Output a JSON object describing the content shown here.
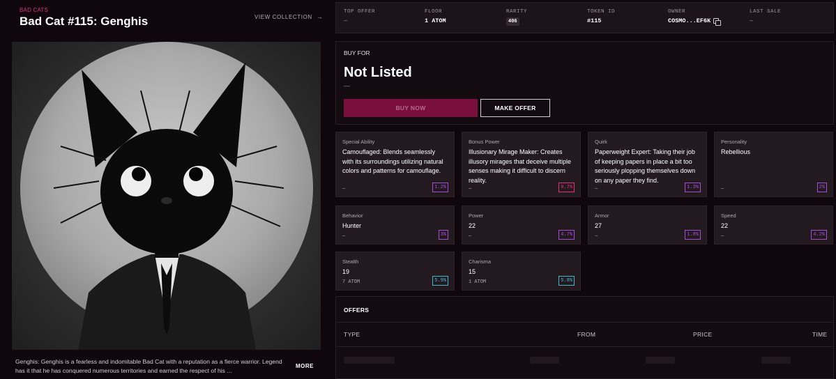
{
  "header": {
    "collection_tag": "BAD CATS",
    "title": "Bad Cat #115: Genghis",
    "view_collection": "VIEW COLLECTION"
  },
  "description": {
    "text": "Genghis: Genghis is a fearless and indomitable Bad Cat with a reputation as a fierce warrior. Legend has it that he has conquered numerous territories and earned the respect of his ...",
    "more_label": "MORE"
  },
  "stats": {
    "top_offer": {
      "label": "TOP OFFER",
      "value": "—"
    },
    "floor": {
      "label": "FLOOR",
      "value": "1 ATOM"
    },
    "rarity": {
      "label": "RARITY",
      "value": "406"
    },
    "token_id": {
      "label": "TOKEN ID",
      "value": "#115"
    },
    "owner": {
      "label": "OWNER",
      "value": "COSMO...EF6K"
    },
    "last_sale": {
      "label": "LAST SALE",
      "value": "—"
    }
  },
  "buy": {
    "label": "BUY FOR",
    "status": "Not Listed",
    "price": "—",
    "buy_now": "BUY NOW",
    "make_offer": "MAKE OFFER"
  },
  "traits": [
    {
      "name": "Special Ability",
      "value": "Camouflaged: Blends seamlessly with its surroundings utilizing natural colors and patterns for camouflage.",
      "price": "—",
      "pct": "1.2%",
      "color": "#a24fd6"
    },
    {
      "name": "Bonus Power",
      "value": "Illusionary Mirage Maker: Creates illusory mirages that deceive multiple senses making it difficult to discern reality.",
      "price": "—",
      "pct": "0.7%",
      "color": "#e0337a"
    },
    {
      "name": "Quirk",
      "value": "Paperweight Expert: Taking their job of keeping papers in place a bit too seriously plopping themselves down on any paper they find.",
      "price": "—",
      "pct": "1.3%",
      "color": "#a24fd6"
    },
    {
      "name": "Personality",
      "value": "Rebellious",
      "price": "—",
      "pct": "2%",
      "color": "#a24fd6"
    },
    {
      "name": "Behavior",
      "value": "Hunter",
      "price": "—",
      "pct": "3%",
      "color": "#a24fd6"
    },
    {
      "name": "Power",
      "value": "22",
      "price": "—",
      "pct": "4.7%",
      "color": "#a24fd6"
    },
    {
      "name": "Armor",
      "value": "27",
      "price": "—",
      "pct": "1.8%",
      "color": "#a24fd6"
    },
    {
      "name": "Speed",
      "value": "22",
      "price": "—",
      "pct": "4.2%",
      "color": "#a24fd6"
    },
    {
      "name": "Stealth",
      "value": "19",
      "price": "7 ATOM",
      "pct": "5.9%",
      "color": "#3fb8c9"
    },
    {
      "name": "Charisma",
      "value": "15",
      "price": "1 ATOM",
      "pct": "5.8%",
      "color": "#3fb8c9"
    }
  ],
  "offers": {
    "title": "OFFERS",
    "columns": [
      "TYPE",
      "FROM",
      "PRICE",
      "TIME"
    ]
  }
}
